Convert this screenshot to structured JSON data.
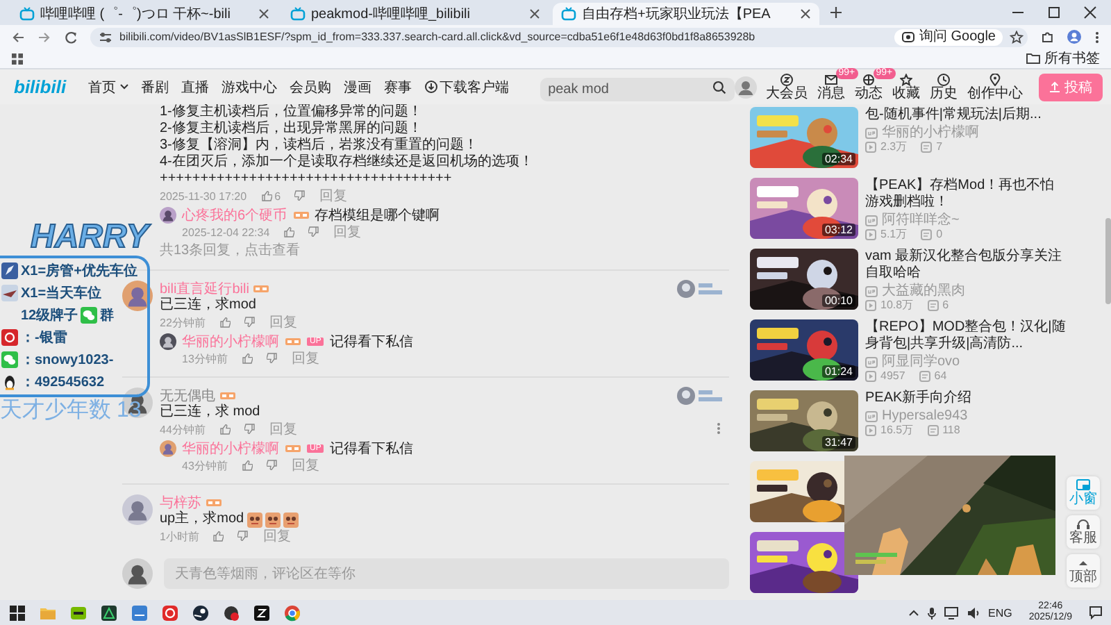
{
  "browser": {
    "tabs": [
      {
        "title": "哔哩哔哩 (゜-゜)つロ 干杯~-bili",
        "selected": false
      },
      {
        "title": "peakmod-哔哩哔哩_bilibili",
        "selected": false
      },
      {
        "title": "自由存档+玩家职业玩法【PEA",
        "selected": true
      }
    ],
    "url": "bilibili.com/video/BV1asSlB1ESF/?spm_id_from=333.337.search-card.all.click&vd_source=cdba51e6f1e48d63f0bd1f8a8653928b",
    "lens_button": "询问 Google",
    "bookmarks_folder": "所有书签"
  },
  "header": {
    "logo": "bilibili",
    "nav": [
      {
        "label": "首页",
        "kind": "menu"
      },
      {
        "label": "番剧",
        "kind": "link"
      },
      {
        "label": "直播",
        "kind": "link"
      },
      {
        "label": "游戏中心",
        "kind": "link"
      },
      {
        "label": "会员购",
        "kind": "link"
      },
      {
        "label": "漫画",
        "kind": "link"
      },
      {
        "label": "赛事",
        "kind": "link"
      },
      {
        "label": "下载客户端",
        "kind": "download"
      }
    ],
    "search": {
      "value": "peak mod"
    },
    "actions": [
      {
        "label": "大会员"
      },
      {
        "label": "消息",
        "badge": "99+"
      },
      {
        "label": "动态",
        "badge": "99+"
      },
      {
        "label": "收藏"
      },
      {
        "label": "历史"
      },
      {
        "label": "创作中心"
      }
    ],
    "upload_button": "投稿"
  },
  "comments": {
    "items": [
      {
        "lines": [
          "1-修复主机读档后，位置偏移异常的问题！",
          "2-修复主机读档后，出现异常黑屏的问题！",
          "3-修复【溶洞】内，读档后，岩浆没有重置的问题！",
          "4-在团灭后，添加一个是读取存档继续还是返回机场的选项！",
          "++++++++++++++++++++++++++++++++++++"
        ],
        "time": "2025-11-30 17:20",
        "likes": "6",
        "reply_link": "回复",
        "fan_card": false,
        "menu": false,
        "stickers": false,
        "replies": [
          {
            "user": "心疼我的6个硬币",
            "text": "存档模组是哪个键啊",
            "time": "2025-12-04 22:34",
            "reply_link": "回复"
          }
        ],
        "reply_count": "共13条回复，点击查看"
      },
      {
        "user": "bili直言延行bili",
        "vip": true,
        "lines": [
          "已三连，求mod"
        ],
        "time": "22分钟前",
        "reply_link": "回复",
        "fan_card": true,
        "menu": false,
        "stickers": false,
        "replies": [
          {
            "user": "华丽的小柠檬啊",
            "badge": "UP",
            "text": "记得看下私信",
            "time": "13分钟前",
            "reply_link": "回复"
          }
        ]
      },
      {
        "user": "无无偶电",
        "vip": false,
        "lines": [
          "已三连，求 mod"
        ],
        "time": "44分钟前",
        "reply_link": "回复",
        "fan_card": true,
        "menu": true,
        "stickers": false,
        "replies": [
          {
            "user": "华丽的小柠檬啊",
            "badge": "UP",
            "text": "记得看下私信",
            "time": "43分钟前",
            "reply_link": "回复"
          }
        ]
      },
      {
        "user": "与梓苏",
        "vip": true,
        "lines": [
          "up主，求mod"
        ],
        "time": "1小时前",
        "reply_link": "回复",
        "fan_card": false,
        "menu": false,
        "stickers": true
      }
    ],
    "input": {
      "placeholder": "天青色等烟雨，评论区在等你"
    }
  },
  "recommendations": [
    {
      "kind": "video",
      "title": "包-随机事件|常规玩法|后期...",
      "author": "华丽的小柠檬啊",
      "views": "2.3万",
      "danmaku": "7",
      "duration": "02:34"
    },
    {
      "kind": "video",
      "title": "【PEAK】存档Mod！再也不怕游戏删档啦！",
      "author": "阿符咩咩念~",
      "views": "5.1万",
      "danmaku": "0",
      "duration": "03:12"
    },
    {
      "kind": "video",
      "title": "vam 最新汉化整合包版分享关注自取哈哈",
      "author": "大益藏的黑肉",
      "views": "10.8万",
      "danmaku": "6",
      "duration": "00:10"
    },
    {
      "kind": "video",
      "title": "【REPO】MOD整合包！汉化|随身背包|共享升级|高清防...",
      "author": "阿显同学ovo",
      "views": "4957",
      "danmaku": "64",
      "duration": "01:24"
    },
    {
      "kind": "video",
      "title": "PEAK新手向介绍",
      "author": "Hypersale943",
      "views": "16.5万",
      "danmaku": "118",
      "duration": "31:47"
    },
    {
      "kind": "picture"
    },
    {
      "kind": "picture"
    }
  ],
  "side_buttons": [
    "小窗",
    "客服",
    "顶部"
  ],
  "overlay": {
    "title": "HARRY",
    "lines": [
      {
        "text": "X1=房管+优先车位"
      },
      {
        "text": "X1=当天车位"
      },
      {
        "text": "12级牌子",
        "suffix": "群"
      },
      {
        "text": "：-银雷"
      },
      {
        "text": "：snowy1023-"
      },
      {
        "text": "：492545632"
      }
    ],
    "counter_label": "天才少年数",
    "counter_value": "13"
  },
  "taskbar": {
    "language": "ENG",
    "time": "22:46",
    "date": "2025/12/9"
  }
}
